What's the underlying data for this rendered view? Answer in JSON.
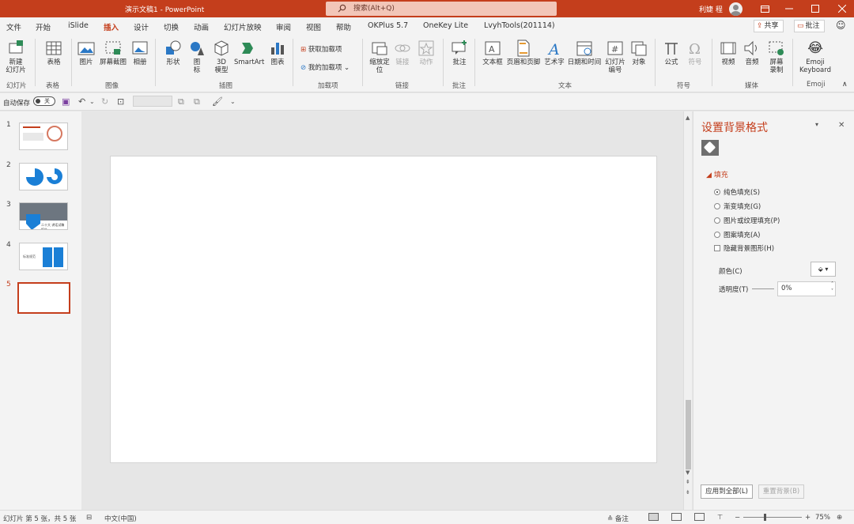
{
  "app": {
    "doc_title": "演示文稿1 - PowerPoint",
    "search_placeholder": "搜索(Alt+Q)",
    "user": "利婕 程"
  },
  "menu": {
    "tabs": [
      "文件",
      "开始",
      "iSlide",
      "插入",
      "设计",
      "切换",
      "动画",
      "幻灯片放映",
      "审阅",
      "视图",
      "帮助",
      "OKPlus 5.7",
      "OneKey Lite",
      "LvyhTools(201114)"
    ],
    "active": "插入",
    "share": "共享",
    "comments": "批注"
  },
  "ribbon": {
    "new_slide": "新建\n幻灯片",
    "table": "表格",
    "picture": "图片",
    "screenshot": "屏幕截图",
    "album": "相册",
    "shapes": "形状",
    "icons": "图\n标",
    "model3d": "3D\n模型",
    "smartart": "SmartArt",
    "chart": "图表",
    "get_addins": "获取加载项",
    "my_addins": "我的加载项",
    "zoom": "缩放定\n位",
    "link": "链接",
    "action": "动作",
    "comment": "批注",
    "textbox": "文本框",
    "header_footer": "页眉和页脚",
    "wordart": "艺术字",
    "datetime": "日期和时间",
    "slide_number": "幻灯片\n编号",
    "object": "对象",
    "equation": "公式",
    "symbol": "符号",
    "video": "视频",
    "audio": "音频",
    "screen_record": "屏幕\n录制",
    "emoji": "Emoji\nKeyboard",
    "groups": {
      "slides": "幻灯片",
      "tables": "表格",
      "images": "图像",
      "illustrations": "插图",
      "addins": "加载项",
      "links": "链接",
      "comments": "批注",
      "text": "文本",
      "symbols": "符号",
      "media": "媒体",
      "emoji": "Emoji"
    }
  },
  "qat": {
    "autosave": "自动保存",
    "toggle": "关"
  },
  "thumbs": {
    "numbers": [
      "1",
      "2",
      "3",
      "4",
      "5"
    ],
    "t3_caption": "二十大 讲话试稿报告",
    "t4_caption": "标准规范"
  },
  "pane": {
    "title": "设置背景格式",
    "section": "填充",
    "options": [
      "纯色填充(S)",
      "渐变填充(G)",
      "图片或纹理填充(P)",
      "图案填充(A)"
    ],
    "hide_bg": "隐藏背景图形(H)",
    "color_label": "颜色(C)",
    "transparency_label": "透明度(T)",
    "transparency_value": "0%",
    "apply_all": "应用到全部(L)",
    "reset_bg": "重置背景(B)"
  },
  "status": {
    "slide_info": "幻灯片 第 5 张，共 5 张",
    "language": "中文(中国)",
    "notes": "备注",
    "zoom": "75%"
  }
}
